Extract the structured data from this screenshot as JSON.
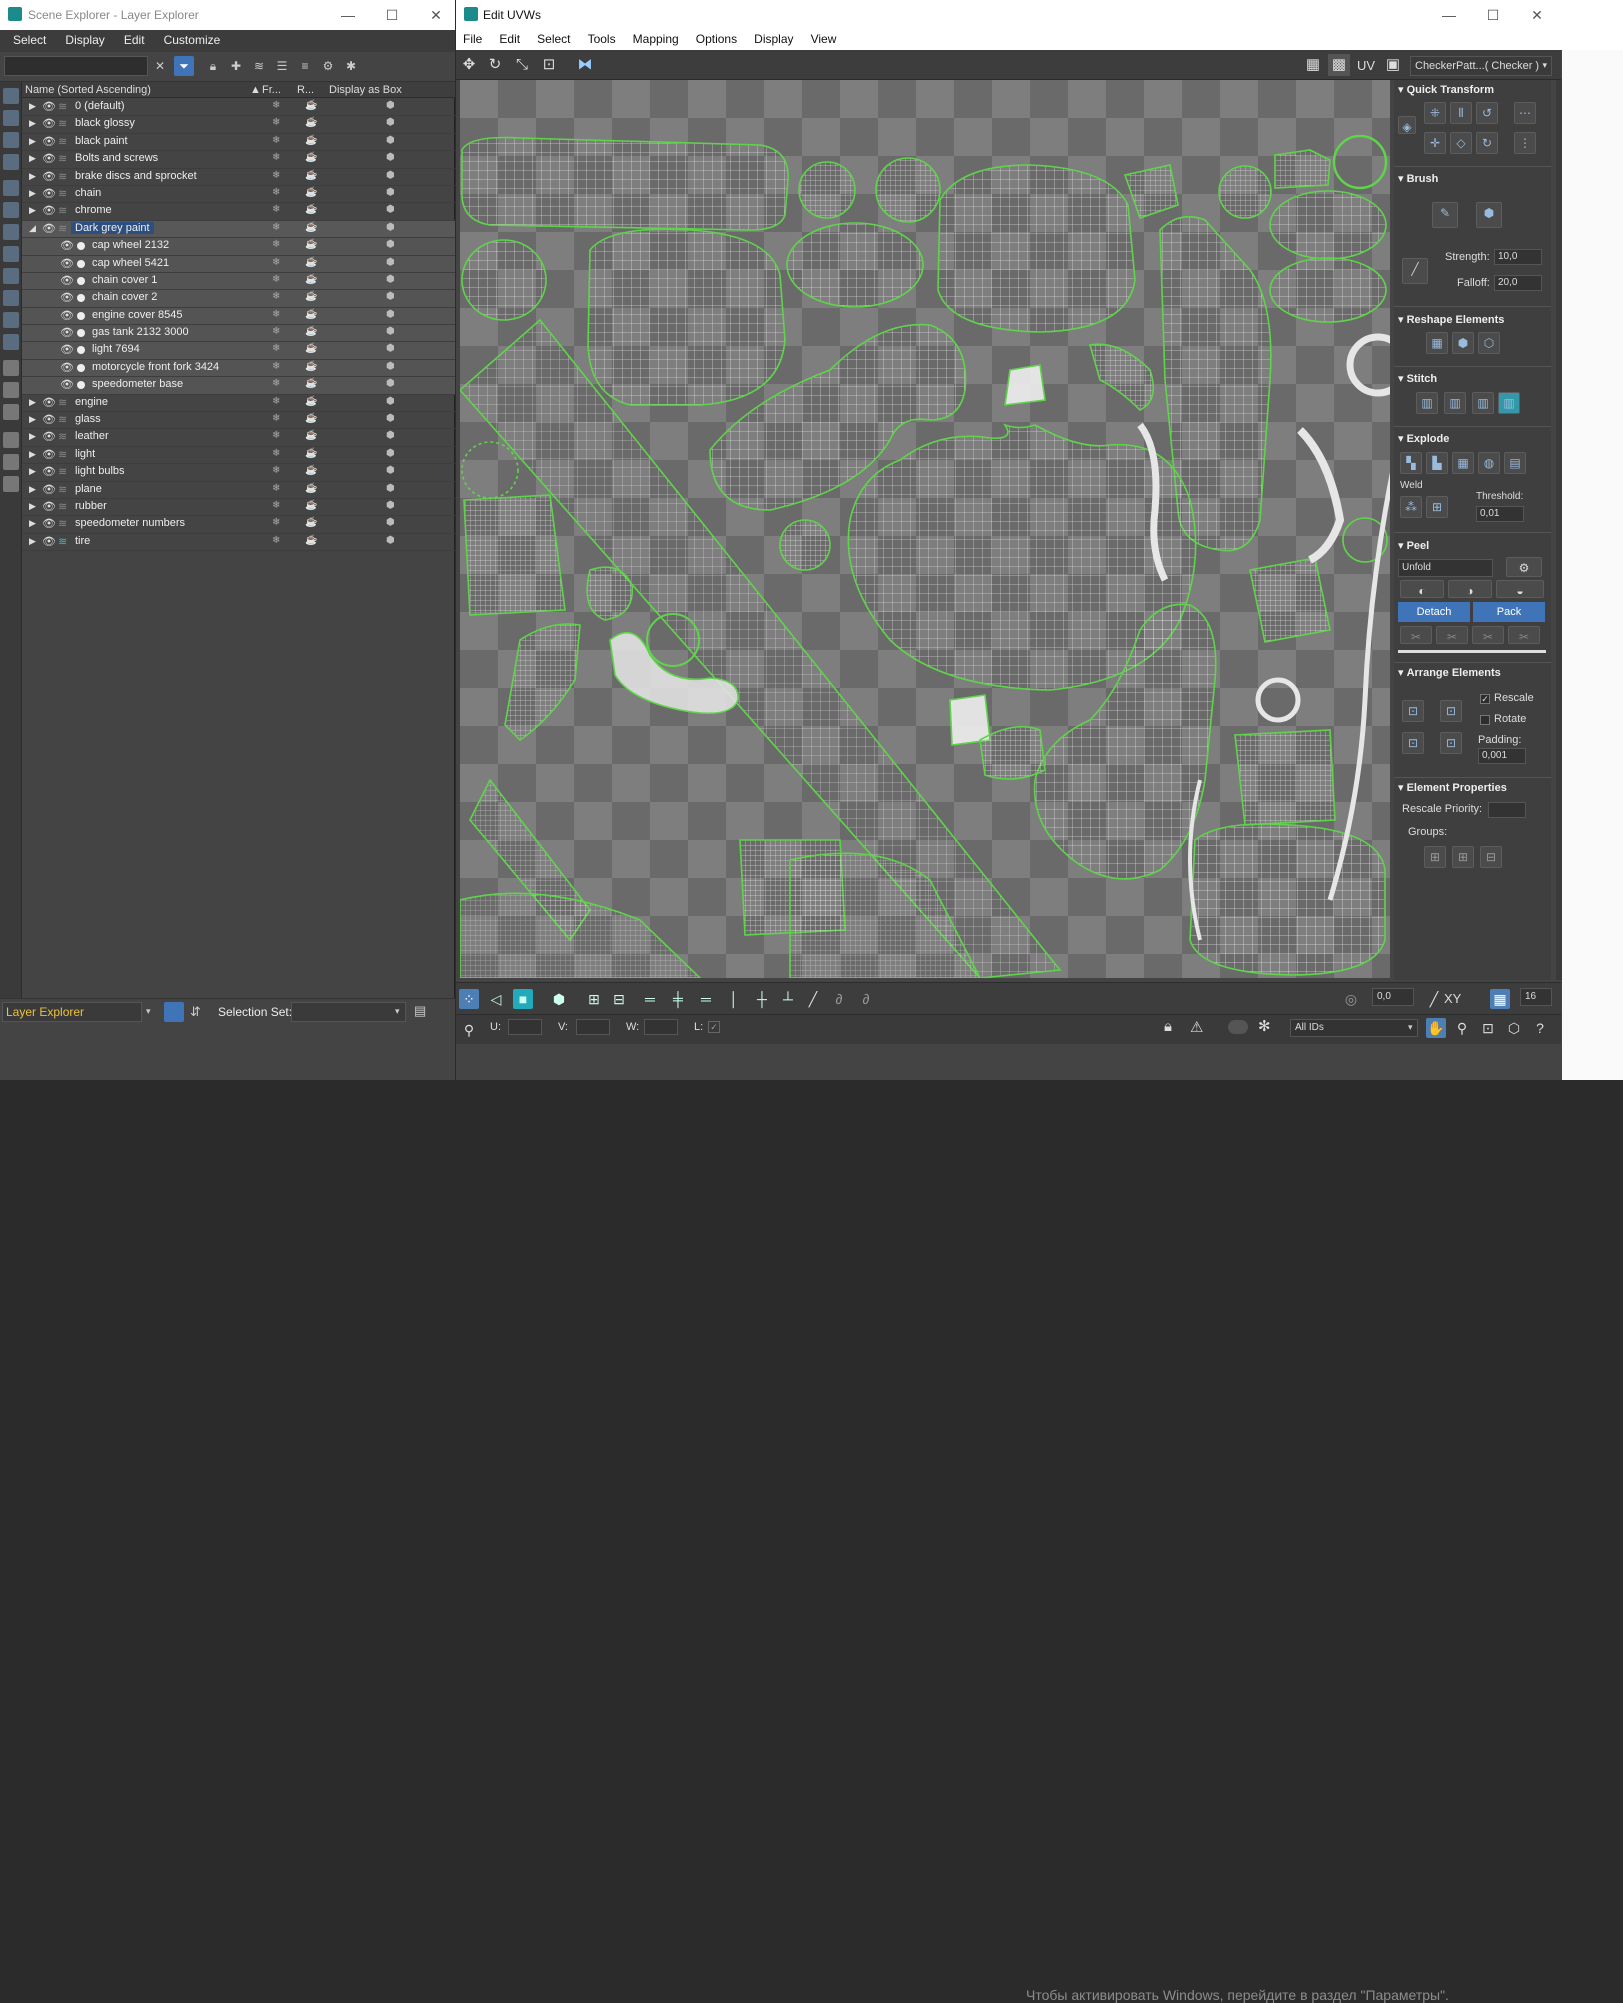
{
  "scene_explorer": {
    "title": "Scene Explorer - Layer Explorer",
    "menu": [
      "Select",
      "Display",
      "Edit",
      "Customize"
    ],
    "columns": {
      "name": "Name (Sorted Ascending)",
      "sort_indicator": "▲",
      "freeze": "Fr...",
      "render": "R...",
      "display_as_box": "Display as Box"
    },
    "layers": [
      {
        "name": "0 (default)"
      },
      {
        "name": "black glossy"
      },
      {
        "name": "black paint"
      },
      {
        "name": "Bolts and screws"
      },
      {
        "name": "brake discs and sprocket"
      },
      {
        "name": "chain"
      },
      {
        "name": "chrome"
      },
      {
        "name": "Dark grey paint"
      }
    ],
    "children": [
      {
        "name": "cap wheel 2132"
      },
      {
        "name": "cap wheel 5421"
      },
      {
        "name": "chain cover 1"
      },
      {
        "name": "chain cover 2"
      },
      {
        "name": "engine cover 8545"
      },
      {
        "name": "gas tank 2132 3000"
      },
      {
        "name": "light 7694"
      },
      {
        "name": "motorcycle front fork 3424"
      },
      {
        "name": "speedometer base"
      }
    ],
    "layers_after": [
      {
        "name": "engine"
      },
      {
        "name": "glass"
      },
      {
        "name": "leather"
      },
      {
        "name": "light"
      },
      {
        "name": "light bulbs"
      },
      {
        "name": "plane"
      },
      {
        "name": "rubber"
      },
      {
        "name": "speedometer numbers"
      },
      {
        "name": "tire"
      }
    ],
    "footer": {
      "explorer_type": "Layer Explorer",
      "selection_set_label": "Selection Set:"
    }
  },
  "uv_editor": {
    "title": "Edit UVWs",
    "menu": [
      "File",
      "Edit",
      "Select",
      "Tools",
      "Mapping",
      "Options",
      "Display",
      "View"
    ],
    "uv_label": "UV",
    "texture_dropdown": "CheckerPatt...( Checker )",
    "panel": {
      "quick_transform": "Quick Transform",
      "brush": "Brush",
      "strength_label": "Strength:",
      "strength_value": "10,0",
      "falloff_label": "Falloff:",
      "falloff_value": "20,0",
      "reshape": "Reshape Elements",
      "stitch": "Stitch",
      "explode": "Explode",
      "weld_label": "Weld",
      "threshold_label": "Threshold:",
      "threshold_value": "0,01",
      "peel": "Peel",
      "peel_mode": "Unfold",
      "detach_label": "Detach",
      "pack_label": "Pack",
      "arrange": "Arrange Elements",
      "rescale_label": "Rescale",
      "rotate_label": "Rotate",
      "padding_label": "Padding:",
      "padding_value": "0,001",
      "element_props": "Element Properties",
      "rescale_priority_label": "Rescale Priority:",
      "groups_label": "Groups:"
    },
    "bottom": {
      "u_label": "U:",
      "v_label": "V:",
      "w_label": "W:",
      "l_label": "L:",
      "angle_value": "0,0",
      "xy_label": "XY",
      "grid_value": "16",
      "ids_dropdown": "All IDs",
      "watermark": "Чтобы активировать Windows, перейдите в раздел \"Параметры\"."
    }
  },
  "colors": {
    "accent": "#3f74b8",
    "uv_edge": "#5fd44a",
    "panel_bg": "#3f3f3f"
  }
}
